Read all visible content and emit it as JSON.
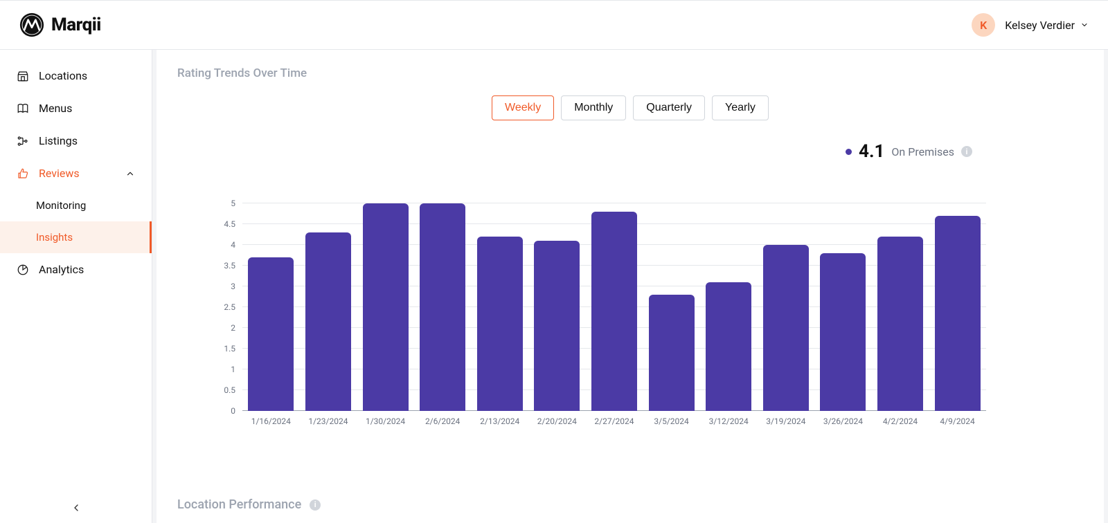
{
  "brand": {
    "name": "Marqii"
  },
  "user": {
    "initial": "K",
    "name": "Kelsey Verdier"
  },
  "sidebar": {
    "items": [
      {
        "label": "Locations"
      },
      {
        "label": "Menus"
      },
      {
        "label": "Listings"
      },
      {
        "label": "Reviews"
      },
      {
        "label": "Monitoring"
      },
      {
        "label": "Insights"
      },
      {
        "label": "Analytics"
      }
    ]
  },
  "section_title": "Rating Trends Over Time",
  "tabs": [
    "Weekly",
    "Monthly",
    "Quarterly",
    "Yearly"
  ],
  "legend": {
    "value": "4.1",
    "label": "On Premises"
  },
  "footer_title": "Location Performance",
  "chart_data": {
    "type": "bar",
    "title": "Rating Trends Over Time",
    "xlabel": "",
    "ylabel": "",
    "ylim": [
      0,
      5
    ],
    "y_ticks": [
      0,
      0.5,
      1,
      1.5,
      2,
      2.5,
      3,
      3.5,
      4,
      4.5,
      5
    ],
    "categories": [
      "1/16/2024",
      "1/23/2024",
      "1/30/2024",
      "2/6/2024",
      "2/13/2024",
      "2/20/2024",
      "2/27/2024",
      "3/5/2024",
      "3/12/2024",
      "3/19/2024",
      "3/26/2024",
      "4/2/2024",
      "4/9/2024"
    ],
    "series": [
      {
        "name": "On Premises",
        "color": "#4b3aa5",
        "values": [
          3.7,
          4.3,
          5.0,
          5.0,
          4.2,
          4.1,
          4.8,
          2.8,
          3.1,
          4.0,
          3.8,
          4.2,
          4.7
        ]
      }
    ]
  }
}
